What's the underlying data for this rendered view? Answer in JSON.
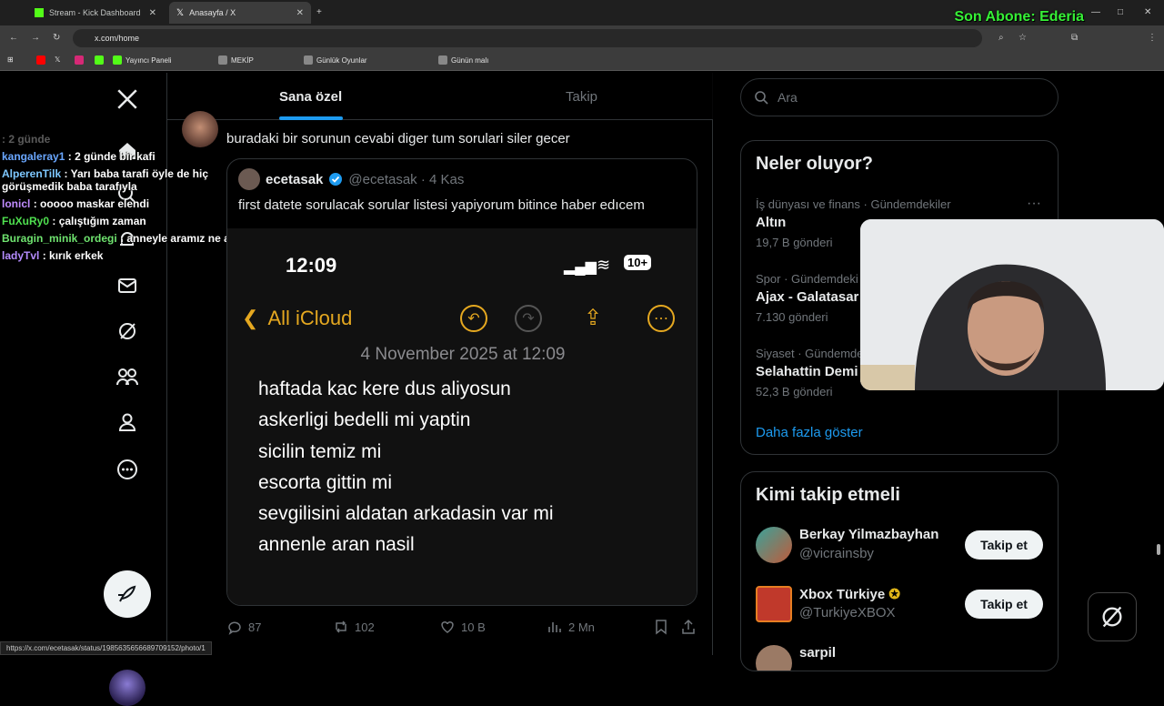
{
  "browser": {
    "tabs": [
      {
        "title": "Stream - Kick Dashboard",
        "active": false
      },
      {
        "title": "Anasayfa / X",
        "active": true
      }
    ],
    "url": "x.com/home",
    "bookmarks": [
      "Yayıncı Paneli",
      "MEKİP",
      "Günlük Oyunlar",
      "Günün malı"
    ],
    "status_url": "https://x.com/ecetasak/status/1985635656689709152/photo/1"
  },
  "overlay": {
    "subscriber": "Son Abone: Ederia"
  },
  "chat": [
    {
      "user": "",
      "text": ": 2 günde",
      "color": "#9aa0a6"
    },
    {
      "user": "kangaleray1",
      "text": ": 2 günde bir kafi",
      "color": "#6aa7ff"
    },
    {
      "user": "AlperenTilk",
      "text": ": Yarı baba tarafi öyle de hiç görüşmedik baba tarafıyla",
      "color": "#7ec8ff"
    },
    {
      "user": "lonicl",
      "text": ": ooooo maskar elendi",
      "color": "#c08cff"
    },
    {
      "user": "FuXuRy0",
      "text": ": çalıştığım zaman",
      "color": "#4fe04f"
    },
    {
      "user": "Buragin_minik_ordegi",
      "text": ": anneyle aramız ne alaka",
      "color": "#6fe36f"
    },
    {
      "user": "ladyTvl",
      "text": ": kırık erkek",
      "color": "#b58cff"
    }
  ],
  "feed": {
    "tab_for_you": "Sana özel",
    "tab_following": "Takip",
    "tweet_text": "buradaki bir sorunun cevabi diger tum sorulari siler gecer",
    "quote": {
      "name": "ecetasak",
      "handle": "@ecetasak · 4 Kas",
      "text": "first datete sorulacak sorular listesi yapiyorum bitince haber edıcem",
      "image": {
        "time": "12:09",
        "battery": "10+",
        "back_label": "All iCloud",
        "date": "4 November 2025 at 12:09",
        "lines": [
          "haftada kac kere dus aliyosun",
          "askerligi bedelli mi yaptin",
          "sicilin temiz mi",
          "escorta gittin mi",
          "sevgilisini aldatan arkadasin var mi",
          "annenle aran nasil"
        ]
      }
    },
    "actions": {
      "replies": "87",
      "reposts": "102",
      "likes": "10 B",
      "views": "2 Mn"
    }
  },
  "sidebar": {
    "search_placeholder": "Ara",
    "trends_title": "Neler oluyor?",
    "trends": [
      {
        "meta": "İş dünyası ve finans · Gündemdekiler",
        "name": "Altın",
        "count": "19,7 B gönderi"
      },
      {
        "meta": "Spor · Gündemdeki",
        "name": "Ajax - Galatasar",
        "count": "7.130 gönderi"
      },
      {
        "meta": "Siyaset · Gündemde",
        "name": "Selahattin Demi",
        "count": "52,3 B gönderi"
      }
    ],
    "show_more": "Daha fazla göster",
    "follow_title": "Kimi takip etmeli",
    "follow": [
      {
        "name": "Berkay Yilmazbayhan",
        "handle": "@vicrainsby",
        "button": "Takip et"
      },
      {
        "name": "Xbox Türkiye",
        "handle": "@TurkiyeXBOX",
        "button": "Takip et"
      },
      {
        "name": "sarpil",
        "handle": "",
        "button": ""
      }
    ]
  }
}
